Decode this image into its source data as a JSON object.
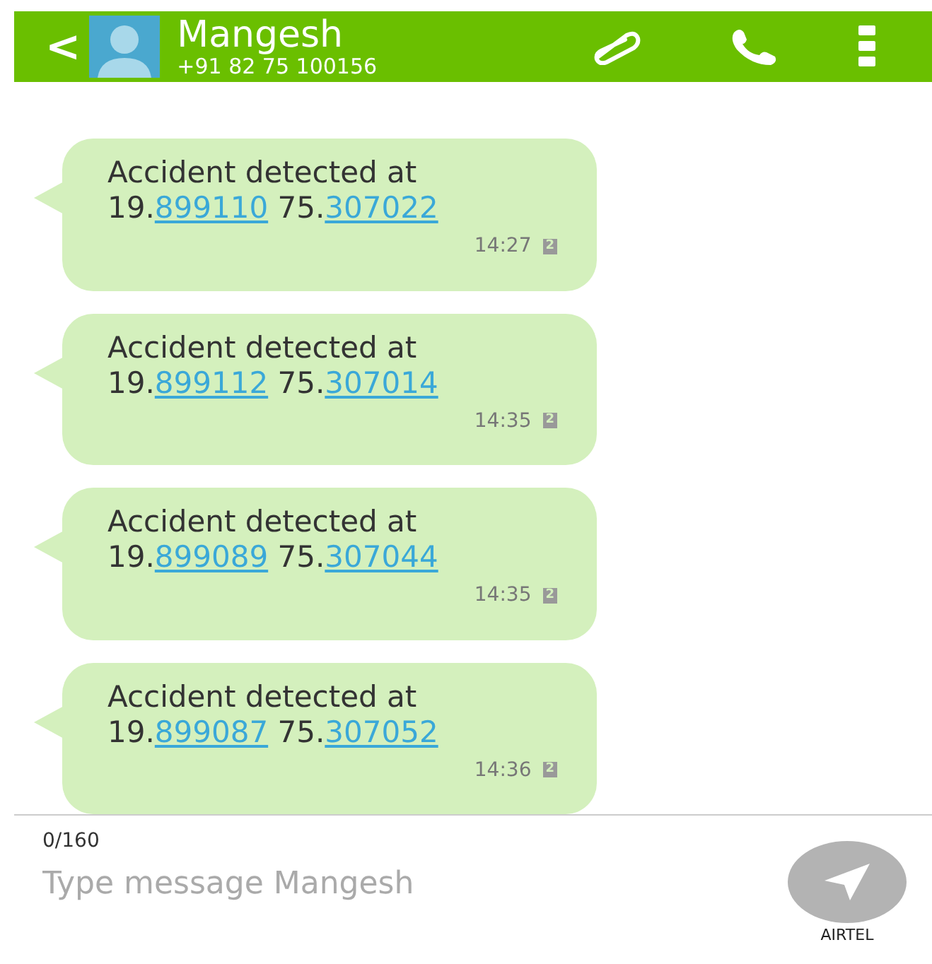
{
  "header": {
    "back": "<",
    "name": "Mangesh",
    "number": "+91 82 75 100156"
  },
  "messages": [
    {
      "text": "Accident detected at",
      "lat_prefix": "19.",
      "lat_link": "899110",
      "lon_prefix": "75.",
      "lon_link": "307022",
      "time": "14:27",
      "sim": "2"
    },
    {
      "text": "Accident detected at",
      "lat_prefix": "19.",
      "lat_link": "899112",
      "lon_prefix": "75.",
      "lon_link": "307014",
      "time": "14:35",
      "sim": "2"
    },
    {
      "text": "Accident detected at",
      "lat_prefix": "19.",
      "lat_link": "899089",
      "lon_prefix": "75.",
      "lon_link": "307044",
      "time": "14:35",
      "sim": "2"
    },
    {
      "text": "Accident detected at",
      "lat_prefix": "19.",
      "lat_link": "899087",
      "lon_prefix": "75.",
      "lon_link": "307052",
      "time": "14:36",
      "sim": "2"
    }
  ],
  "composer": {
    "counter": "0/160",
    "placeholder": "Type message Mangesh",
    "send_label": "AIRTEL"
  }
}
